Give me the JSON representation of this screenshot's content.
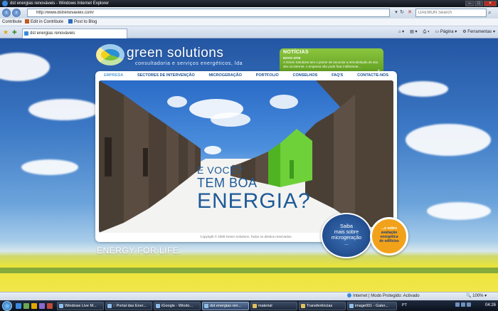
{
  "window": {
    "title": "dst energias renováveis - Windows Internet Explorer"
  },
  "address": {
    "url": "http://www.dstrenovaveis.com/",
    "search_placeholder": "DAEMON Search"
  },
  "linksbar": {
    "contribute": "Contribute",
    "edit_in_contribute": "Edit in Contribute",
    "post_to_blog": "Post to Blog"
  },
  "tabs": {
    "active_label": "dst energias renováveis"
  },
  "commandbar": {
    "page": "Página",
    "tools": "Ferramentas"
  },
  "site": {
    "logo_title": "green solutions",
    "logo_tagline": "consultadoria e serviços energéticos, lda",
    "nav": [
      "EMPRESA",
      "SECTORES DE INTERVENÇÃO",
      "MICROGERAÇÃO",
      "PORTFOLIO",
      "CONSELHOS",
      "FAQ'S",
      "CONTACTE-NOS"
    ],
    "news": {
      "title": "NOTÍCIAS",
      "subtitle": "NOVO SITE",
      "body": "A Green Solutions tem o prazer de anunciar a remodelação do seu site na internet. A empresa não pode ficar indiferente..."
    },
    "hero": {
      "line1": "E VOCÊ?",
      "line2": "TEM BOA",
      "line3": "ENERGIA?"
    },
    "copyright": "Copyright © 2009 Green Solutions. Todos os direitos reservados.",
    "badge_blue": {
      "line1": "Saiba",
      "line2": "mais sobre",
      "line3": "microgeração",
      "line4": "..."
    },
    "badge_orange": {
      "line1": "...e sobre",
      "line2": "avaliação",
      "line3": "energética",
      "line4": "de edifícios"
    },
    "slogan": "ENERGY FOR LIFE."
  },
  "status": {
    "zone": "Internet | Modo Protegido: Activado",
    "zoom": "100%"
  },
  "taskbar": {
    "tasks": [
      "Windows Live M...",
      ":: Portal das Ener...",
      "iGoogle - Windo...",
      "dst energias ren...",
      "material",
      "Transferências",
      "image001 - Galer..."
    ],
    "lang": "PT",
    "clock": "04:26"
  },
  "colors": {
    "brand_green": "#8cc63f",
    "brand_blue": "#1d5a96",
    "badge_orange": "#f2a21a"
  }
}
